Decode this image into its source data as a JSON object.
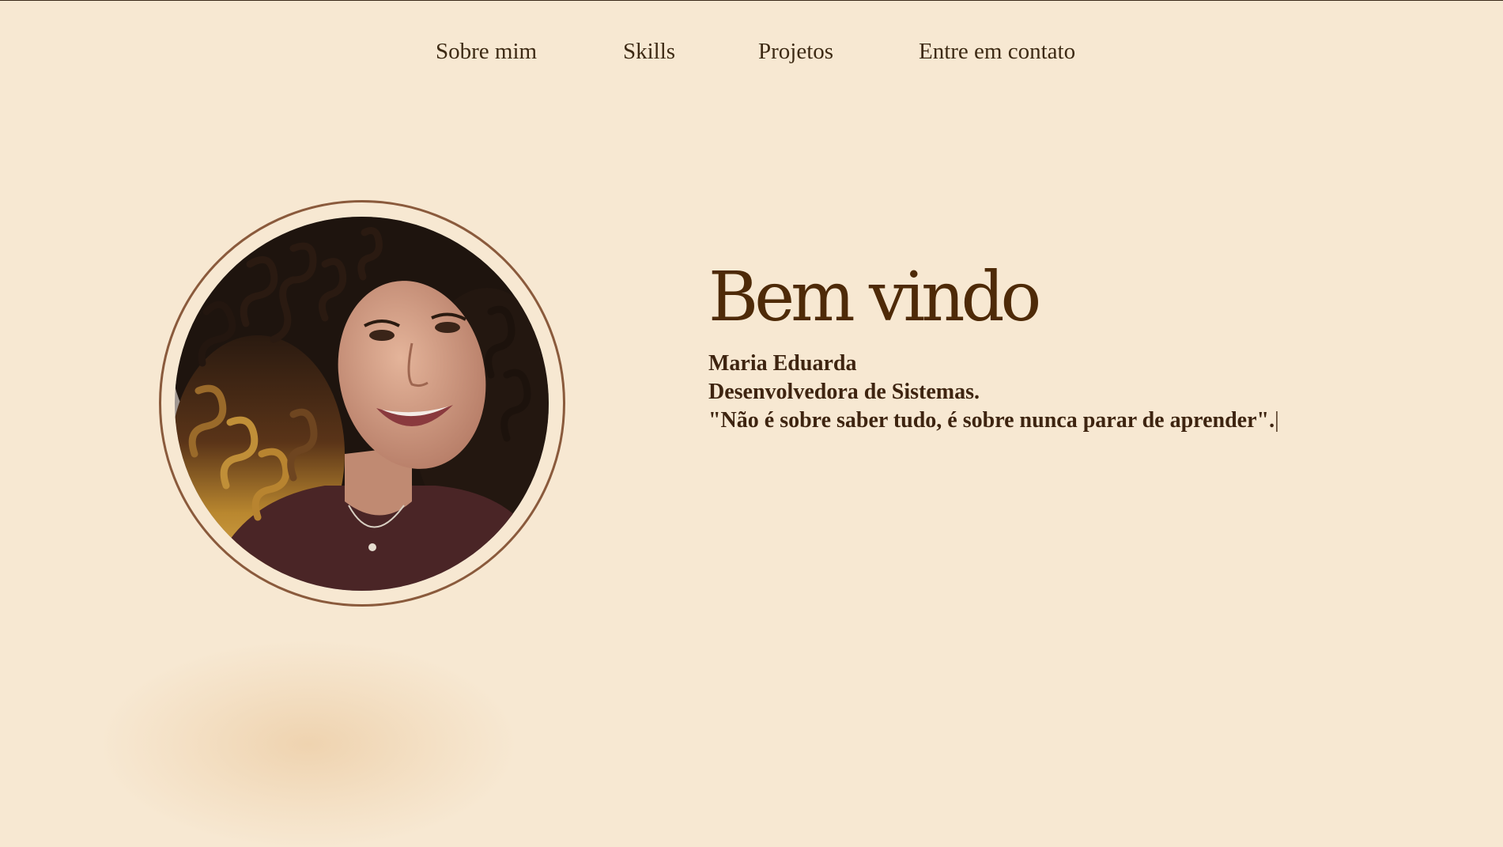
{
  "nav": {
    "items": [
      {
        "label": "Sobre mim"
      },
      {
        "label": "Skills"
      },
      {
        "label": "Projetos"
      },
      {
        "label": "Entre em contato"
      }
    ]
  },
  "hero": {
    "title": "Bem vindo",
    "name": "Maria Eduarda",
    "role": "Desenvolvedora de Sistemas.",
    "quote": "\"Não é sobre saber tudo, é sobre nunca parar de aprender\".",
    "cursor": "|"
  },
  "colors": {
    "background": "#f7e8d2",
    "text": "#4a2a0c",
    "ring": "#8a5a3c"
  }
}
